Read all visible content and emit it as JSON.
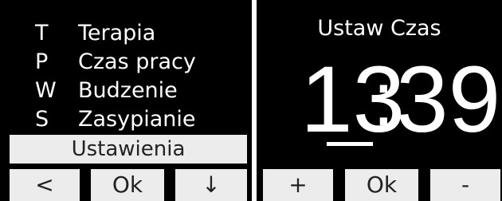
{
  "left_screen": {
    "menu": [
      {
        "key": "T",
        "label": "Terapia"
      },
      {
        "key": "P",
        "label": "Czas pracy"
      },
      {
        "key": "W",
        "label": "Budzenie"
      },
      {
        "key": "S",
        "label": "Zasypianie"
      }
    ],
    "selected": "Ustawienia",
    "softkeys": {
      "left": "<",
      "center": "Ok",
      "right": "↓"
    }
  },
  "right_screen": {
    "title": "Ustaw Czas",
    "time": {
      "hours": "13",
      "separator": ":",
      "minutes": "39"
    },
    "softkeys": {
      "left": "+",
      "center": "Ok",
      "right": "-"
    }
  }
}
